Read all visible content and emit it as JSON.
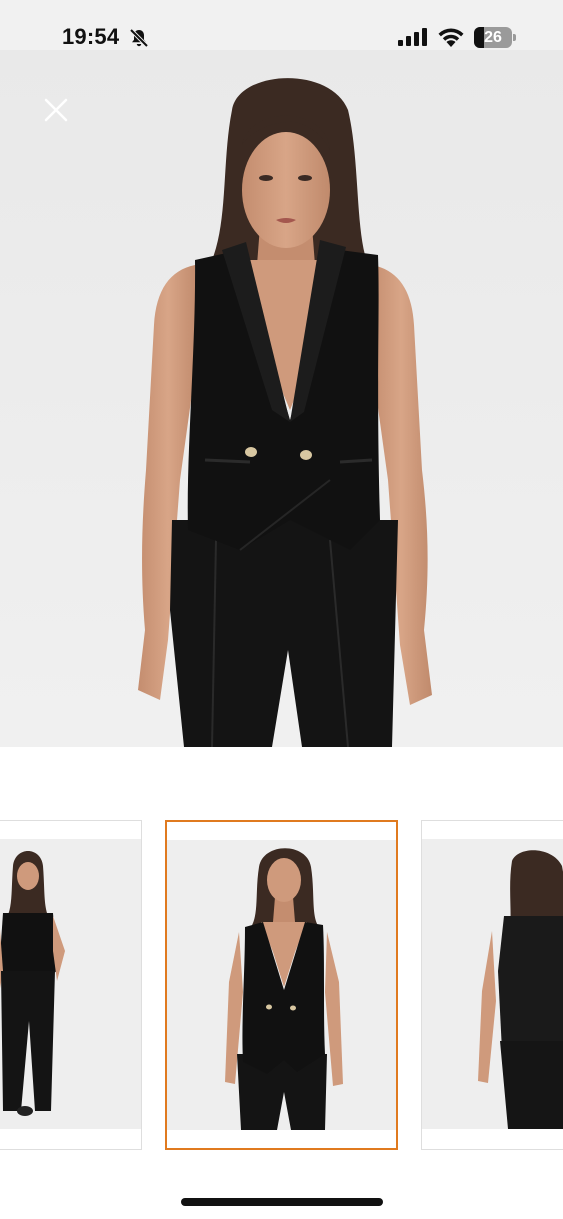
{
  "status_bar": {
    "time": "19:54",
    "battery_level": "26",
    "icons": [
      "bell-slash-icon",
      "signal-icon",
      "wifi-icon",
      "battery-icon"
    ]
  },
  "gallery": {
    "close_icon": "close-icon",
    "image_count": 3,
    "selected_index": 1,
    "selected_border_color": "#e07a1f",
    "images": [
      {
        "view": "full-length-front"
      },
      {
        "view": "front-close"
      },
      {
        "view": "back"
      }
    ]
  },
  "colors": {
    "background": "#ebebeb",
    "garment": "#111111",
    "skin": "#cf9a7c",
    "buttons": "#d8c7a1"
  }
}
